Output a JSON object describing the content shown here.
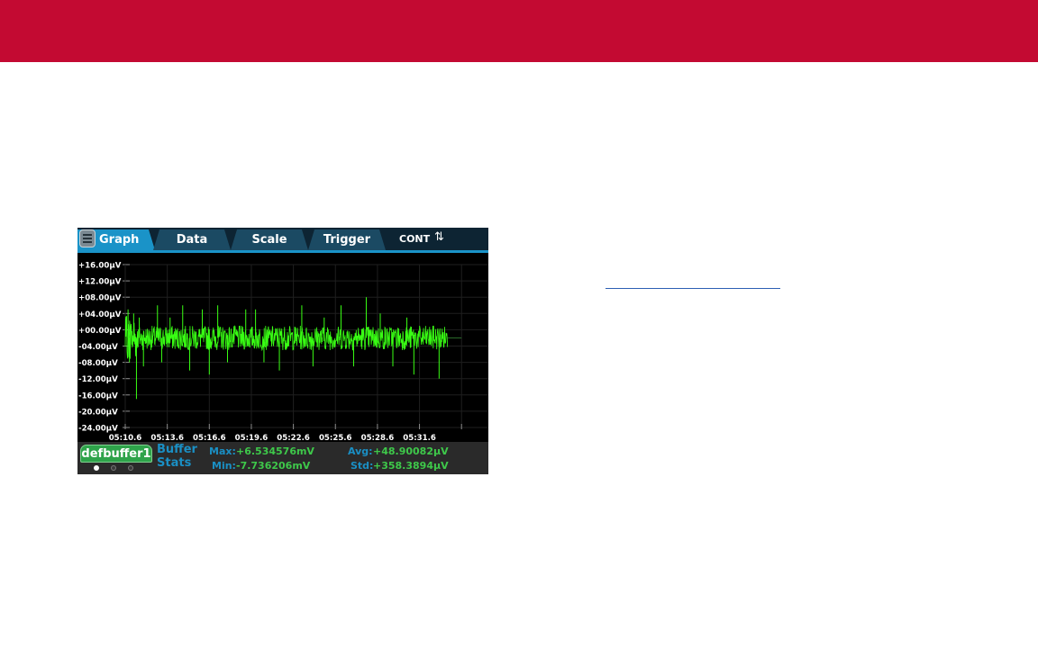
{
  "colors": {
    "banner": "#c30a32",
    "trace": "#39ff14",
    "tab_active": "#1a93c8",
    "tab_inactive": "#1b4a63",
    "buffer_badge": "#2ea34a",
    "stat_label": "#1a8fc4",
    "stat_value": "#3ec84a"
  },
  "tabs": [
    {
      "label": "Graph",
      "active": true
    },
    {
      "label": "Data",
      "active": false
    },
    {
      "label": "Scale",
      "active": false
    },
    {
      "label": "Trigger",
      "active": false
    }
  ],
  "menu_icon": "hamburger-menu-icon",
  "trigger_mode": {
    "label": "CONT",
    "icon": "refresh-icon",
    "glyph": "⇅"
  },
  "buffer": {
    "name": "defbuffer1",
    "pages": [
      true,
      false,
      false
    ],
    "stats_title_line1": "Buffer",
    "stats_title_line2": "Stats",
    "max_label": "Max:",
    "max_value": "+6.534576mV",
    "min_label": "Min:",
    "min_value": "-7.736206mV",
    "avg_label": "Avg:",
    "avg_value": "+48.90082µV",
    "std_label": "Std:",
    "std_value": "+358.3894µV"
  },
  "chart_data": {
    "type": "line",
    "title": "",
    "xlabel": "",
    "ylabel": "",
    "y_tick_labels": [
      "+16.00µV",
      "+12.00µV",
      "+08.00µV",
      "+04.00µV",
      "+00.00µV",
      "-04.00µV",
      "-08.00µV",
      "-12.00µV",
      "-16.00µV",
      "-20.00µV",
      "-24.00µV"
    ],
    "y_ticks": [
      16,
      12,
      8,
      4,
      0,
      -4,
      -8,
      -12,
      -16,
      -20,
      -24
    ],
    "ylim": [
      -24,
      16
    ],
    "x_tick_labels": [
      "05:10.6",
      "05:13.6",
      "05:16.6",
      "05:19.6",
      "05:22.6",
      "05:25.6",
      "05:28.6",
      "05:31.6"
    ],
    "x_ticks": [
      0,
      3,
      6,
      9,
      12,
      15,
      18,
      21
    ],
    "xlim": [
      0,
      24
    ],
    "grid": true,
    "series": [
      {
        "x_start": 0,
        "x_end": 23,
        "baseline": -2,
        "noise_band": [
          -5,
          1
        ],
        "spikes": [
          {
            "x": 0.2,
            "y": 5
          },
          {
            "x": 0.3,
            "y": -8
          },
          {
            "x": 0.6,
            "y": 4
          },
          {
            "x": 0.8,
            "y": -17
          },
          {
            "x": 1.0,
            "y": 3
          },
          {
            "x": 1.3,
            "y": -9
          },
          {
            "x": 2.3,
            "y": 6
          },
          {
            "x": 2.6,
            "y": -8
          },
          {
            "x": 3.2,
            "y": 3
          },
          {
            "x": 4.1,
            "y": 6
          },
          {
            "x": 4.6,
            "y": -10
          },
          {
            "x": 5.5,
            "y": 5
          },
          {
            "x": 6.0,
            "y": -11
          },
          {
            "x": 6.6,
            "y": 6
          },
          {
            "x": 7.3,
            "y": -8
          },
          {
            "x": 8.6,
            "y": 5
          },
          {
            "x": 9.3,
            "y": 5
          },
          {
            "x": 9.9,
            "y": -8
          },
          {
            "x": 11.0,
            "y": -10
          },
          {
            "x": 12.6,
            "y": 6
          },
          {
            "x": 13.4,
            "y": -9
          },
          {
            "x": 14.2,
            "y": 3
          },
          {
            "x": 15.4,
            "y": 6
          },
          {
            "x": 16.3,
            "y": -9
          },
          {
            "x": 17.2,
            "y": 8
          },
          {
            "x": 18.2,
            "y": 4
          },
          {
            "x": 19.1,
            "y": -9
          },
          {
            "x": 20.1,
            "y": 3
          },
          {
            "x": 20.6,
            "y": -11
          },
          {
            "x": 22.0,
            "y": 1
          },
          {
            "x": 22.4,
            "y": -12
          }
        ]
      }
    ]
  }
}
